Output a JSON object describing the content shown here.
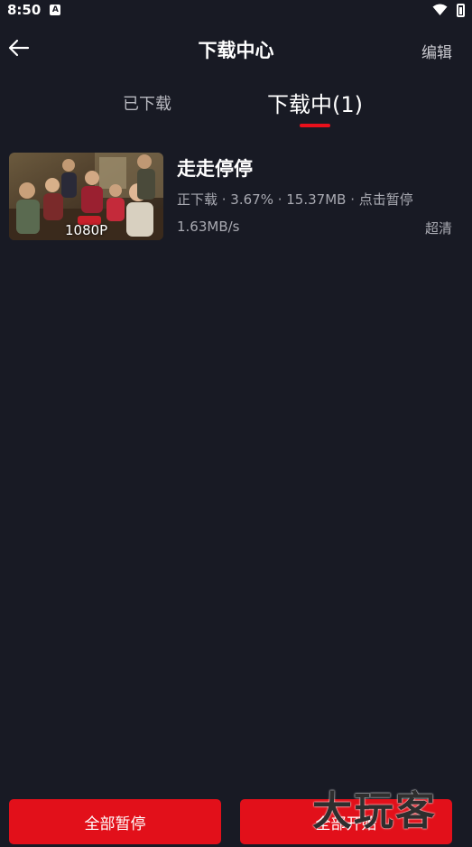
{
  "status_bar": {
    "time": "8:50",
    "app_icon_glyph": "A",
    "icons": [
      "wifi-icon",
      "battery-icon"
    ]
  },
  "header": {
    "back_icon": "arrow-left-icon",
    "title": "下载中心",
    "edit_label": "编辑"
  },
  "tabs": [
    {
      "label": "已下载",
      "active": false
    },
    {
      "label": "下载中(1)",
      "active": true
    }
  ],
  "accent_color": "#e2101a",
  "downloads": [
    {
      "title": "走走停停",
      "status_line": "正下载 · 3.67% · 15.37MB · 点击暂停",
      "progress_percent": 3.67,
      "downloaded_size": "15.37MB",
      "speed": "1.63MB/s",
      "quality": "超清",
      "resolution": "1080P"
    }
  ],
  "actions": {
    "pause_all": "全部暂停",
    "start_all": "全部开始"
  },
  "watermark": "大玩客"
}
